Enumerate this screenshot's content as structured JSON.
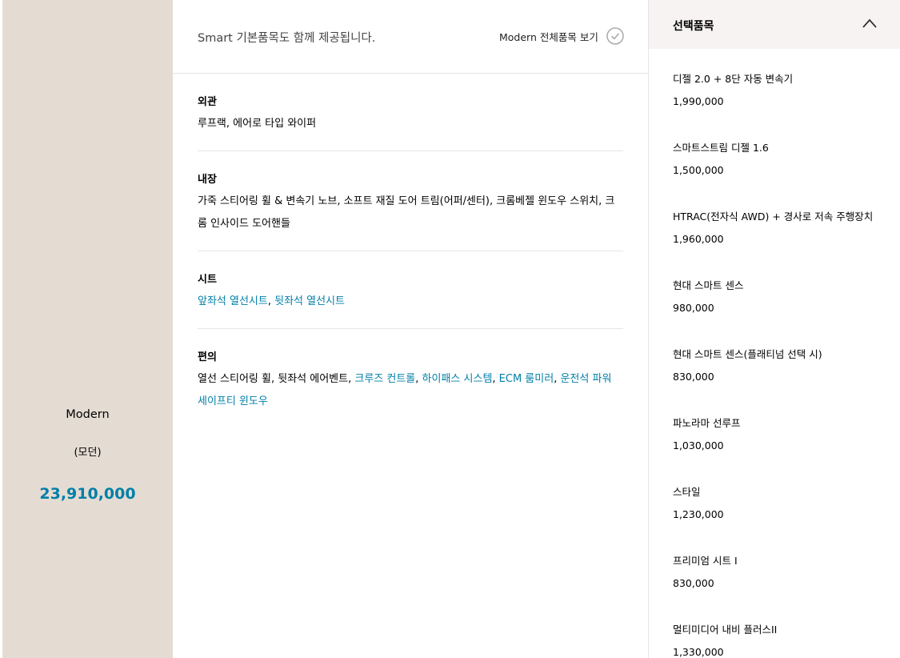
{
  "trim": {
    "name": "Modern",
    "sub": "(모던)",
    "price": "23,910,000"
  },
  "header": {
    "notice": "Smart 기본품목도 함께 제공됩니다.",
    "view_all_label": "Modern 전체품목 보기"
  },
  "sections": [
    {
      "title": "외관",
      "parts": [
        {
          "text": "루프랙, 에어로 타입 와이퍼",
          "highlight": false
        }
      ]
    },
    {
      "title": "내장",
      "parts": [
        {
          "text": "가죽 스티어링 휠 & 변속기 노브, 소프트 재질 도어 트림(어퍼/센터), 크롬베젤 윈도우 스위치, 크롬 인사이드 도어핸들",
          "highlight": false
        }
      ]
    },
    {
      "title": "시트",
      "parts": [
        {
          "text": "앞좌석 열선시트",
          "highlight": true
        },
        {
          "text": ", ",
          "highlight": false
        },
        {
          "text": "뒷좌석 열선시트",
          "highlight": true
        }
      ]
    },
    {
      "title": "편의",
      "parts": [
        {
          "text": "열선 스티어링 휠, 뒷좌석 에어벤트, ",
          "highlight": false
        },
        {
          "text": "크루즈 컨트롤",
          "highlight": true
        },
        {
          "text": ", ",
          "highlight": false
        },
        {
          "text": "하이패스 시스템",
          "highlight": true
        },
        {
          "text": ", ",
          "highlight": false
        },
        {
          "text": "ECM 룸미러",
          "highlight": true
        },
        {
          "text": ", ",
          "highlight": false
        },
        {
          "text": "운전석 파워 세이프티 윈도우",
          "highlight": true
        }
      ]
    }
  ],
  "options": {
    "title": "선택품목",
    "items": [
      {
        "name": "디젤 2.0 + 8단 자동 변속기",
        "price": "1,990,000"
      },
      {
        "name": "스마트스트림 디젤 1.6",
        "price": "1,500,000"
      },
      {
        "name": "HTRAC(전자식 AWD) + 경사로 저속 주행장치",
        "price": "1,960,000"
      },
      {
        "name": "현대 스마트 센스",
        "price": "980,000"
      },
      {
        "name": "현대 스마트 센스(플래티넘 선택 시)",
        "price": "830,000"
      },
      {
        "name": "파노라마 선루프",
        "price": "1,030,000"
      },
      {
        "name": "스타일",
        "price": "1,230,000"
      },
      {
        "name": "프리미엄 시트 I",
        "price": "830,000"
      },
      {
        "name": "멀티미디어 내비 플러스II",
        "price": "1,330,000"
      }
    ]
  },
  "colors": {
    "accent": "#007fa8",
    "trim_bg": "#e4dcd3",
    "side_head_bg": "#f6f3f2"
  }
}
